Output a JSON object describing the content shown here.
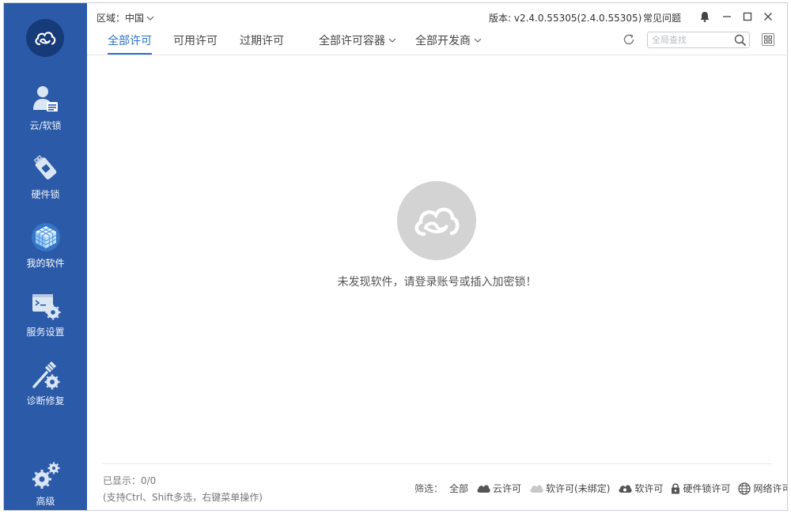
{
  "sidebar": {
    "items": [
      {
        "label": "云/软锁"
      },
      {
        "label": "硬件锁"
      },
      {
        "label": "我的软件"
      },
      {
        "label": "服务设置"
      },
      {
        "label": "诊断修复"
      },
      {
        "label": "高级"
      }
    ],
    "active_index": 2
  },
  "header": {
    "region_label": "区域：中国",
    "version": "版本: v2.4.0.55305(2.4.0.55305)",
    "faq": "常见问题"
  },
  "tabs": [
    {
      "label": "全部许可",
      "active": true
    },
    {
      "label": "可用许可",
      "active": false
    },
    {
      "label": "过期许可",
      "active": false
    }
  ],
  "dropdowns": {
    "container": "全部许可容器",
    "developer": "全部开发商"
  },
  "search": {
    "placeholder": "全局查找",
    "value": ""
  },
  "empty_state": {
    "message": "未发现软件，请登录账号或插入加密锁！"
  },
  "footer": {
    "shown": "已显示：0/0",
    "hint": "(支持Ctrl、Shift多选，右键菜单操作)",
    "filter_label": "筛选：",
    "filters": [
      "全部",
      "云许可",
      "软许可(未绑定)",
      "软许可",
      "硬件锁许可",
      "网络许可"
    ]
  },
  "colors": {
    "sidebar_bg": "#2a5aa8",
    "logo_bg": "#173a78",
    "accent": "#2a6fc4",
    "empty_icon": "#d3d3d3"
  }
}
